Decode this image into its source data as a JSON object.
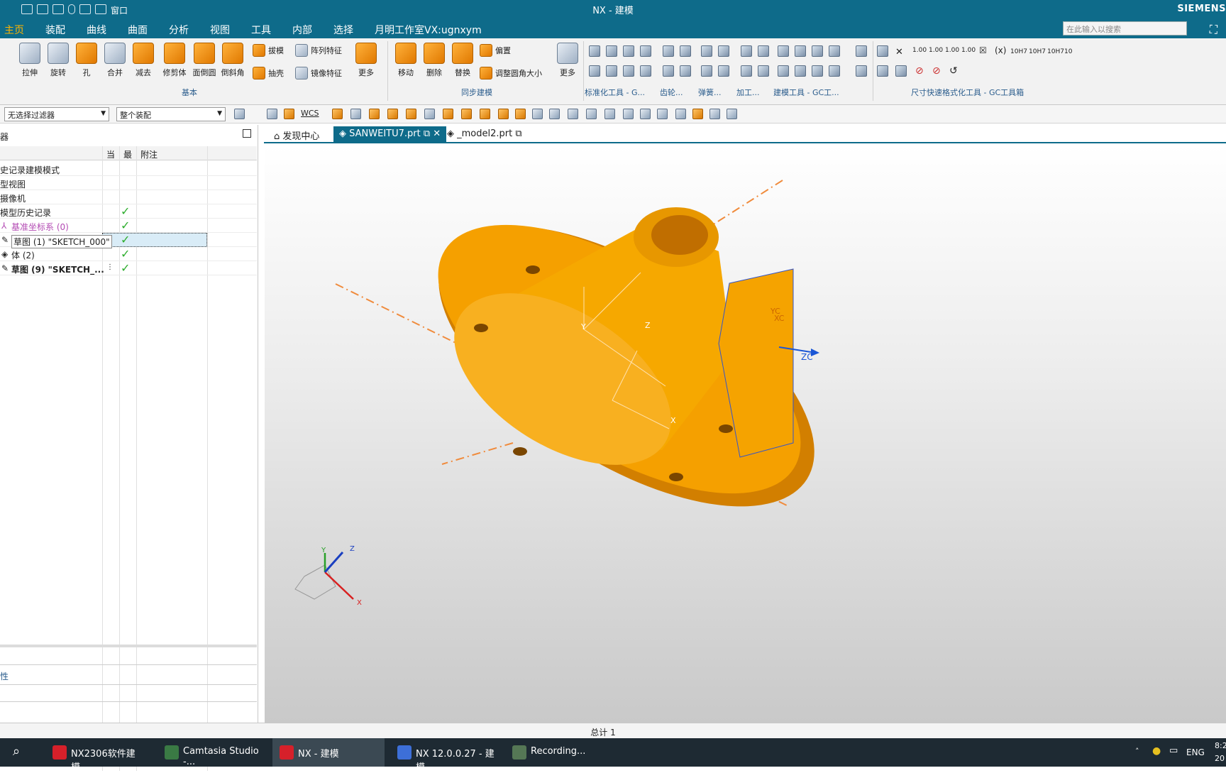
{
  "window": {
    "title": "NX - 建模",
    "brand": "SIEMENS"
  },
  "quick_access": {
    "window_menu": "窗口"
  },
  "menu_tabs": [
    "主页",
    "装配",
    "曲线",
    "曲面",
    "分析",
    "视图",
    "工具",
    "内部",
    "选择",
    "月明工作室VX:ugnxym"
  ],
  "search": {
    "placeholder": "在此输入以搜索"
  },
  "ribbon": {
    "basic": [
      "拉伸",
      "旋转",
      "孔",
      "合并",
      "减去",
      "修剪体",
      "面倒圆",
      "倒斜角"
    ],
    "basic_small": [
      "拔模",
      "阵列特征",
      "抽壳",
      "镜像特征"
    ],
    "more": "更多",
    "group_basic": "基本",
    "sync": [
      "移动",
      "删除",
      "替换"
    ],
    "sync_small": [
      "偏置",
      "调整圆角大小"
    ],
    "group_sync": "同步建模",
    "group_labels": [
      "标准化工具 - G...",
      "齿轮...",
      "弹簧...",
      "加工...",
      "建模工具 - GC工...",
      "尺寸快速格式化工具 - GC工具箱"
    ],
    "dim_texts": [
      "1.00",
      "1.00",
      "1.00",
      "1.00",
      "10H7",
      "10H7",
      "10H7",
      "10"
    ]
  },
  "selection_bar": {
    "filter": "无选择过滤器",
    "scope": "整个装配",
    "wcs": "WCS"
  },
  "navigator": {
    "columns": [
      "当",
      "最",
      "附注"
    ],
    "rows": [
      {
        "label": "史记录建模模式",
        "check": false
      },
      {
        "label": "型视图",
        "check": false
      },
      {
        "label": "摄像机",
        "check": false
      },
      {
        "label": "模型历史记录",
        "check": true
      },
      {
        "label": "基准坐标系 (0)",
        "check": true
      },
      {
        "label": "草图 (1) \"SKETCH_000\"",
        "check": true
      },
      {
        "label": "体 (2)",
        "check": true
      },
      {
        "label": "草图 (9) \"SKETCH_...",
        "check": true
      }
    ],
    "bottom_label": "性"
  },
  "doc_tabs": [
    "发现中心",
    "SANWEITU7.prt",
    "_model2.prt"
  ],
  "viewport": {
    "axis_labels": [
      "Y",
      "Z",
      "X",
      "YC",
      "XC",
      "ZC"
    ],
    "triad": [
      "Y",
      "Z",
      "X"
    ]
  },
  "status": {
    "text": "总计 1"
  },
  "taskbar": {
    "items": [
      "NX2306软件建模....",
      "Camtasia Studio -...",
      "NX - 建模",
      "NX 12.0.0.27 - 建模",
      "Recording..."
    ],
    "lang": "ENG",
    "time": "8:2",
    "date": "20"
  },
  "colors": {
    "accent": "#0e6b8a",
    "active_tab": "#ffb400",
    "model": "#f5a000"
  }
}
